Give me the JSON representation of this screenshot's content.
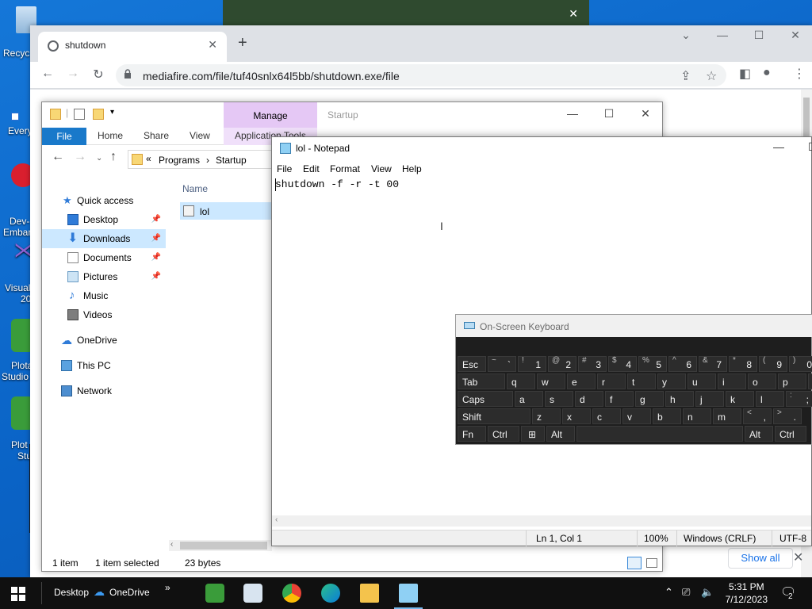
{
  "desktop": {
    "icons": [
      {
        "label": "Recyc"
      },
      {
        "label": "Every"
      },
      {
        "label": "Embar",
        "label2": "Dev-"
      },
      {
        "label": "Visual",
        "label2": "20"
      },
      {
        "label": "Plota",
        "label2": "Studio"
      },
      {
        "label": "Plot",
        "label2": "Stu"
      }
    ],
    "dark_bar_close": "✕"
  },
  "chrome": {
    "tab_title": "shutdown",
    "tab_close": "✕",
    "new_tab": "+",
    "url": "mediafire.com/file/tuf40snlx64l5bb/shutdown.exe/file",
    "show_all": "Show all",
    "show_all_close": "✕"
  },
  "explorer": {
    "manage": "Manage",
    "window_title": "Startup",
    "ribbon": {
      "file": "File",
      "home": "Home",
      "share": "Share",
      "view": "View",
      "app_tools": "Application Tools"
    },
    "address": {
      "chevron": "«",
      "seg1": "Programs",
      "sep": "›",
      "seg2": "Startup"
    },
    "nav": {
      "quick_access": "Quick access",
      "desktop": "Desktop",
      "downloads": "Downloads",
      "documents": "Documents",
      "pictures": "Pictures",
      "music": "Music",
      "videos": "Videos",
      "onedrive": "OneDrive",
      "this_pc": "This PC",
      "network": "Network"
    },
    "column_name": "Name",
    "file": {
      "name": "lol"
    },
    "status": {
      "count": "1 item",
      "selected": "1 item selected",
      "size": "23 bytes"
    }
  },
  "notepad": {
    "title": "lol - Notepad",
    "menu": [
      "File",
      "Edit",
      "Format",
      "View",
      "Help"
    ],
    "content": "shutdown -f -r -t 00",
    "status": {
      "position": "Ln 1, Col 1",
      "zoom": "100%",
      "line_ending": "Windows (CRLF)",
      "encoding": "UTF-8"
    }
  },
  "osk": {
    "title": "On-Screen Keyboard",
    "row1": [
      {
        "main": "Esc"
      },
      {
        "sub": "~",
        "main": "`"
      },
      {
        "sub": "!",
        "main": "1"
      },
      {
        "sub": "@",
        "main": "2"
      },
      {
        "sub": "#",
        "main": "3"
      },
      {
        "sub": "$",
        "main": "4"
      },
      {
        "sub": "%",
        "main": "5"
      },
      {
        "sub": "^",
        "main": "6"
      },
      {
        "sub": "&",
        "main": "7"
      },
      {
        "sub": "*",
        "main": "8"
      },
      {
        "sub": "(",
        "main": "9"
      },
      {
        "sub": ")",
        "main": "0"
      }
    ],
    "row2": [
      "Tab",
      "q",
      "w",
      "e",
      "r",
      "t",
      "y",
      "u",
      "i",
      "o",
      "p"
    ],
    "row2_brace": "{",
    "row3": [
      "Caps",
      "a",
      "s",
      "d",
      "f",
      "g",
      "h",
      "j",
      "k",
      "l"
    ],
    "row3_punct": {
      "sub": ":",
      "main": ";"
    },
    "row4": [
      "Shift",
      "z",
      "x",
      "c",
      "v",
      "b",
      "n",
      "m"
    ],
    "row4_punct": [
      {
        "sub": "<",
        "main": ","
      },
      {
        "sub": ">",
        "main": "."
      }
    ],
    "row5": {
      "fn": "Fn",
      "ctrl": "Ctrl",
      "alt": "Alt",
      "alt_r": "Alt",
      "ctrl_r": "Ctrl"
    }
  },
  "taskbar": {
    "desktop": "Desktop",
    "onedrive": "OneDrive",
    "overflow": "»",
    "time": "5:31 PM",
    "date": "7/12/2023",
    "notifications": "2"
  },
  "colors": {
    "accent": "#1979ca",
    "manage_tab": "#e5c8f5",
    "selection": "#cce8ff"
  }
}
